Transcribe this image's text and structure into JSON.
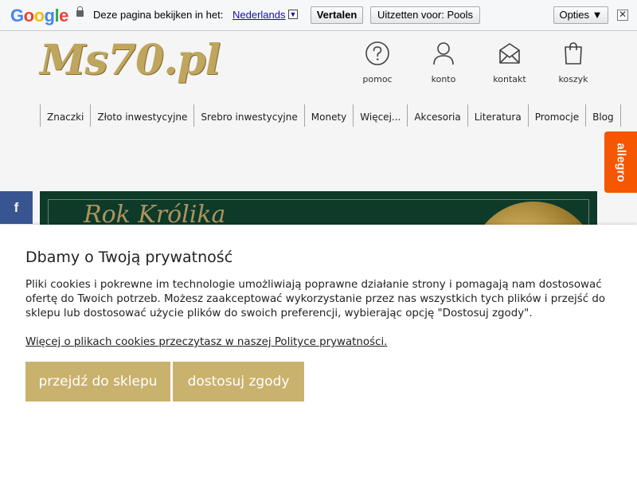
{
  "translate_bar": {
    "logo": [
      "G",
      "o",
      "o",
      "g",
      "l",
      "e"
    ],
    "prompt": "Deze pagina bekijken in het:",
    "language": "Nederlands",
    "dropdown_glyph": "▼",
    "translate_button": "Vertalen",
    "turn_off_button": "Uitzetten voor: Pools",
    "options_button": "Opties ▼",
    "close_glyph": "✕"
  },
  "header": {
    "logo": "Ms70.pl",
    "icons": [
      {
        "label": "pomoc",
        "icon": "question-circle-icon"
      },
      {
        "label": "konto",
        "icon": "user-icon"
      },
      {
        "label": "kontakt",
        "icon": "envelope-icon"
      },
      {
        "label": "koszyk",
        "icon": "shopping-bag-icon"
      }
    ]
  },
  "nav": [
    "Znaczki",
    "Złoto inwestycyjne",
    "Srebro inwestycyjne",
    "Monety",
    "Więcej...",
    "Akcesoria",
    "Literatura",
    "Promocje",
    "Blog"
  ],
  "banner": {
    "text": "Rok Królika"
  },
  "social": {
    "facebook": "f",
    "allegro": "allegro"
  },
  "cookie": {
    "title": "Dbamy o Twoją prywatność",
    "body": "Pliki cookies i pokrewne im technologie umożliwiają poprawne działanie strony i pomagają nam dostosować ofertę do Twoich potrzeb. Możesz zaakceptować wykorzystanie przez nas wszystkich tych plików i przejść do sklepu lub dostosować użycie plików do swoich preferencji, wybierając opcję \"Dostosuj zgody\".",
    "link": "Więcej o plikach cookies przeczytasz w naszej Polityce prywatności.",
    "accept_button": "przejdź do sklepu",
    "customize_button": "dostosuj zgody"
  },
  "colors": {
    "gold": "#c9b26e",
    "facebook": "#3b5998",
    "allegro": "#ff5a00",
    "banner": "#0f3d2c"
  }
}
